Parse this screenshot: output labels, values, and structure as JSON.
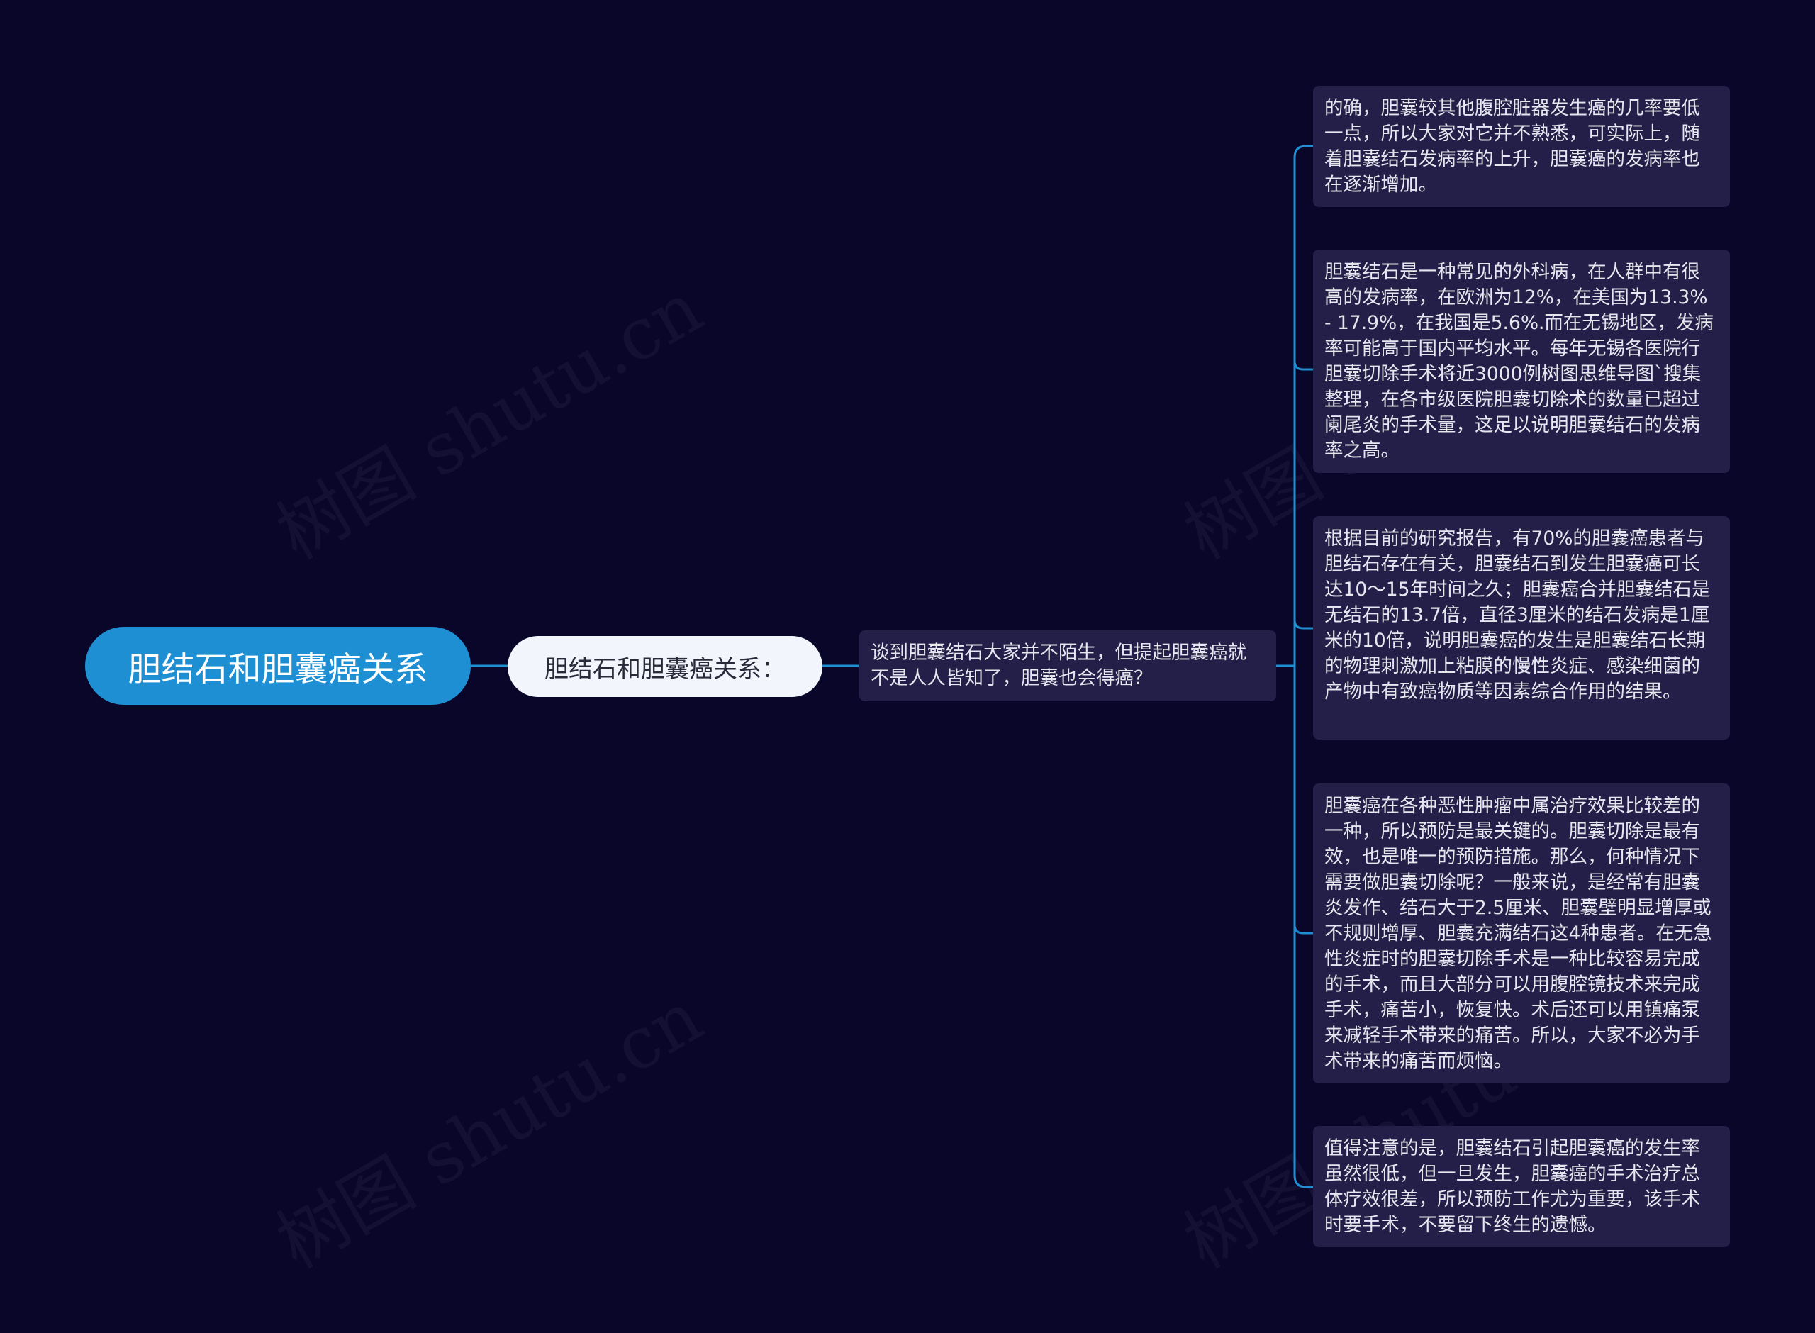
{
  "watermark": "树图 shutu.cn",
  "colors": {
    "background": "#0a062a",
    "root_fill": "#1d8fd2",
    "branch_fill": "#f2f5fc",
    "leaf_fill": "#241f48",
    "connector": "#1d8fd2"
  },
  "mindmap": {
    "root": "胆结石和胆囊癌关系",
    "branch": "胆结石和胆囊癌关系：",
    "intro": "谈到胆囊结石大家并不陌生，但提起胆囊癌就不是人人皆知了，胆囊也会得癌？",
    "leaves": [
      "的确，胆囊较其他腹腔脏器发生癌的几率要低一点，所以大家对它并不熟悉，可实际上，随着胆囊结石发病率的上升，胆囊癌的发病率也在逐渐增加。",
      "胆囊结石是一种常见的外科病，在人群中有很高的发病率，在欧洲为12%，在美国为13.3% - 17.9%，在我国是5.6%.而在无锡地区，发病率可能高于国内平均水平。每年无锡各医院行胆囊切除手术将近3000例树图思维导图`搜集整理，在各市级医院胆囊切除术的数量已超过阑尾炎的手术量，这足以说明胆囊结石的发病率之高。",
      "根据目前的研究报告，有70%的胆囊癌患者与胆结石存在有关，胆囊结石到发生胆囊癌可长达10～15年时间之久；胆囊癌合并胆囊结石是无结石的13.7倍，直径3厘米的结石发病是1厘米的10倍，说明胆囊癌的发生是胆囊结石长期的物理刺激加上粘膜的慢性炎症、感染细菌的产物中有致癌物质等因素综合作用的结果。",
      "胆囊癌在各种恶性肿瘤中属治疗效果比较差的一种，所以预防是最关键的。胆囊切除是最有效，也是唯一的预防措施。那么，何种情况下需要做胆囊切除呢？一般来说，是经常有胆囊炎发作、结石大于2.5厘米、胆囊壁明显增厚或不规则增厚、胆囊充满结石这4种患者。在无急性炎症时的胆囊切除手术是一种比较容易完成的手术，而且大部分可以用腹腔镜技术来完成手术，痛苦小，恢复快。术后还可以用镇痛泵来减轻手术带来的痛苦。所以，大家不必为手术带来的痛苦而烦恼。",
      "值得注意的是，胆囊结石引起胆囊癌的发生率虽然很低，但一旦发生，胆囊癌的手术治疗总体疗效很差，所以预防工作尤为重要，该手术时要手术，不要留下终生的遗憾。"
    ]
  }
}
